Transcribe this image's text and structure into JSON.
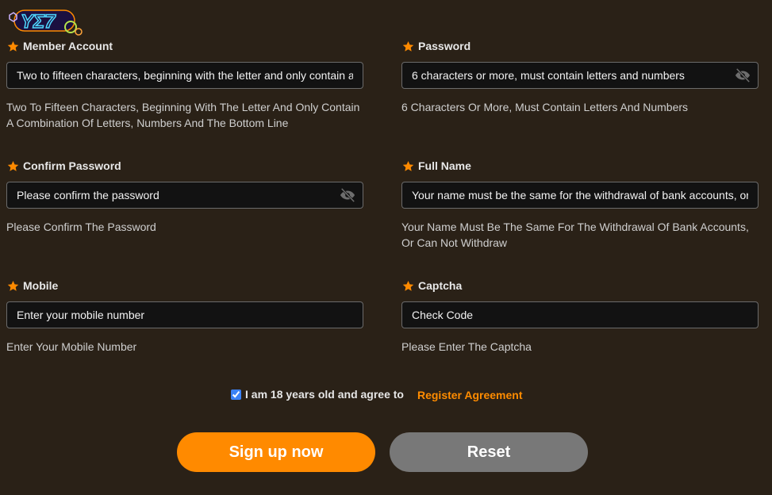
{
  "brand": {
    "logo_text": "YE7",
    "logo_icon": "brand-logo"
  },
  "colors": {
    "background": "#2a2117",
    "accent": "#ff8a00",
    "reset": "#787878",
    "link": "#ff8c00"
  },
  "fields": [
    {
      "label": "Member Account",
      "placeholder": "Two to fifteen characters, beginning with the letter and only contain a combination of letters, numbers and the bottom line",
      "hint": "Two To Fifteen Characters, Beginning With The Letter And Only Contain A Combination Of Letters, Numbers And The Bottom Line",
      "required_icon": "star-icon"
    },
    {
      "label": "Password",
      "placeholder": "6 characters or more, must contain letters and numbers",
      "hint": "6 Characters Or More, Must Contain Letters And Numbers",
      "required_icon": "star-icon",
      "toggle_icon": "eye-slash-icon"
    },
    {
      "label": "Confirm Password",
      "placeholder": "Please confirm the password",
      "hint": "Please Confirm The Password",
      "required_icon": "star-icon",
      "toggle_icon": "eye-slash-icon"
    },
    {
      "label": "Full Name",
      "placeholder": "Your name must be the same for the withdrawal of bank accounts, or can not withdraw",
      "hint": "Your Name Must Be The Same For The Withdrawal Of Bank Accounts, Or Can Not Withdraw",
      "required_icon": "star-icon"
    },
    {
      "label": "Mobile",
      "placeholder": "Enter your mobile number",
      "hint": "Enter Your Mobile Number",
      "required_icon": "star-icon"
    },
    {
      "label": "Captcha",
      "placeholder": "Check Code",
      "hint": "Please Enter The Captcha",
      "required_icon": "star-icon"
    }
  ],
  "agreement": {
    "checked": true,
    "text": "I am 18 years old and agree to",
    "link": "Register Agreement"
  },
  "buttons": {
    "signup": "Sign up now",
    "reset": "Reset"
  }
}
